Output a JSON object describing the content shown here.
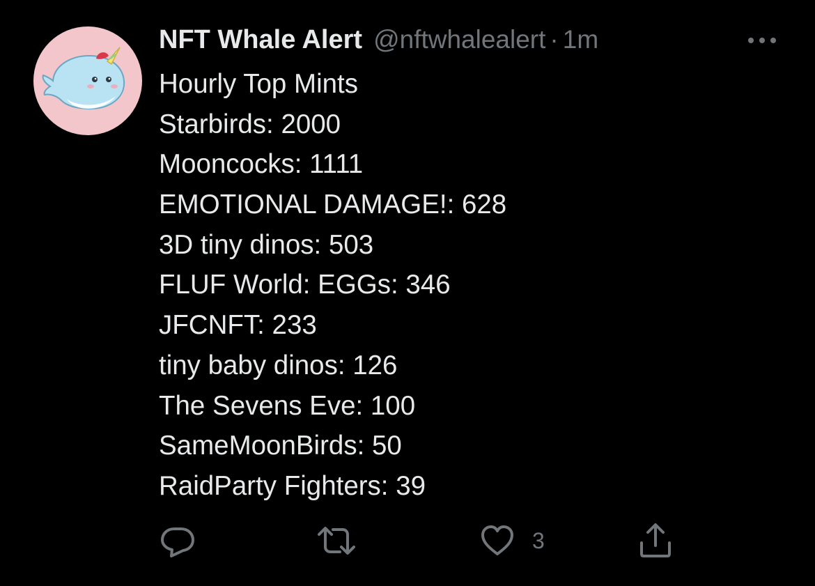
{
  "tweet": {
    "author": {
      "display_name": "NFT Whale Alert",
      "handle": "@nftwhalealert",
      "separator": "·",
      "time": "1m",
      "avatar_icon": "narwhal-avatar"
    },
    "lines": [
      "Hourly Top Mints",
      "Starbirds: 2000",
      "Mooncocks: 1111",
      "EMOTIONAL DAMAGE!: 628",
      "3D tiny dinos: 503",
      "FLUF World: EGGs: 346",
      "JFCNFT: 233",
      "tiny baby dinos: 126",
      "The Sevens Eve: 100",
      "SameMoonBirds: 50",
      "RaidParty Fighters: 39"
    ],
    "actions": {
      "reply_icon": "reply-icon",
      "retweet_icon": "retweet-icon",
      "like_icon": "heart-icon",
      "like_count": "3",
      "share_icon": "share-icon"
    }
  },
  "colors": {
    "background": "#000000",
    "primary_text": "#e7e9ea",
    "secondary_text": "#71767b",
    "avatar_bg": "#f3c6cb"
  }
}
